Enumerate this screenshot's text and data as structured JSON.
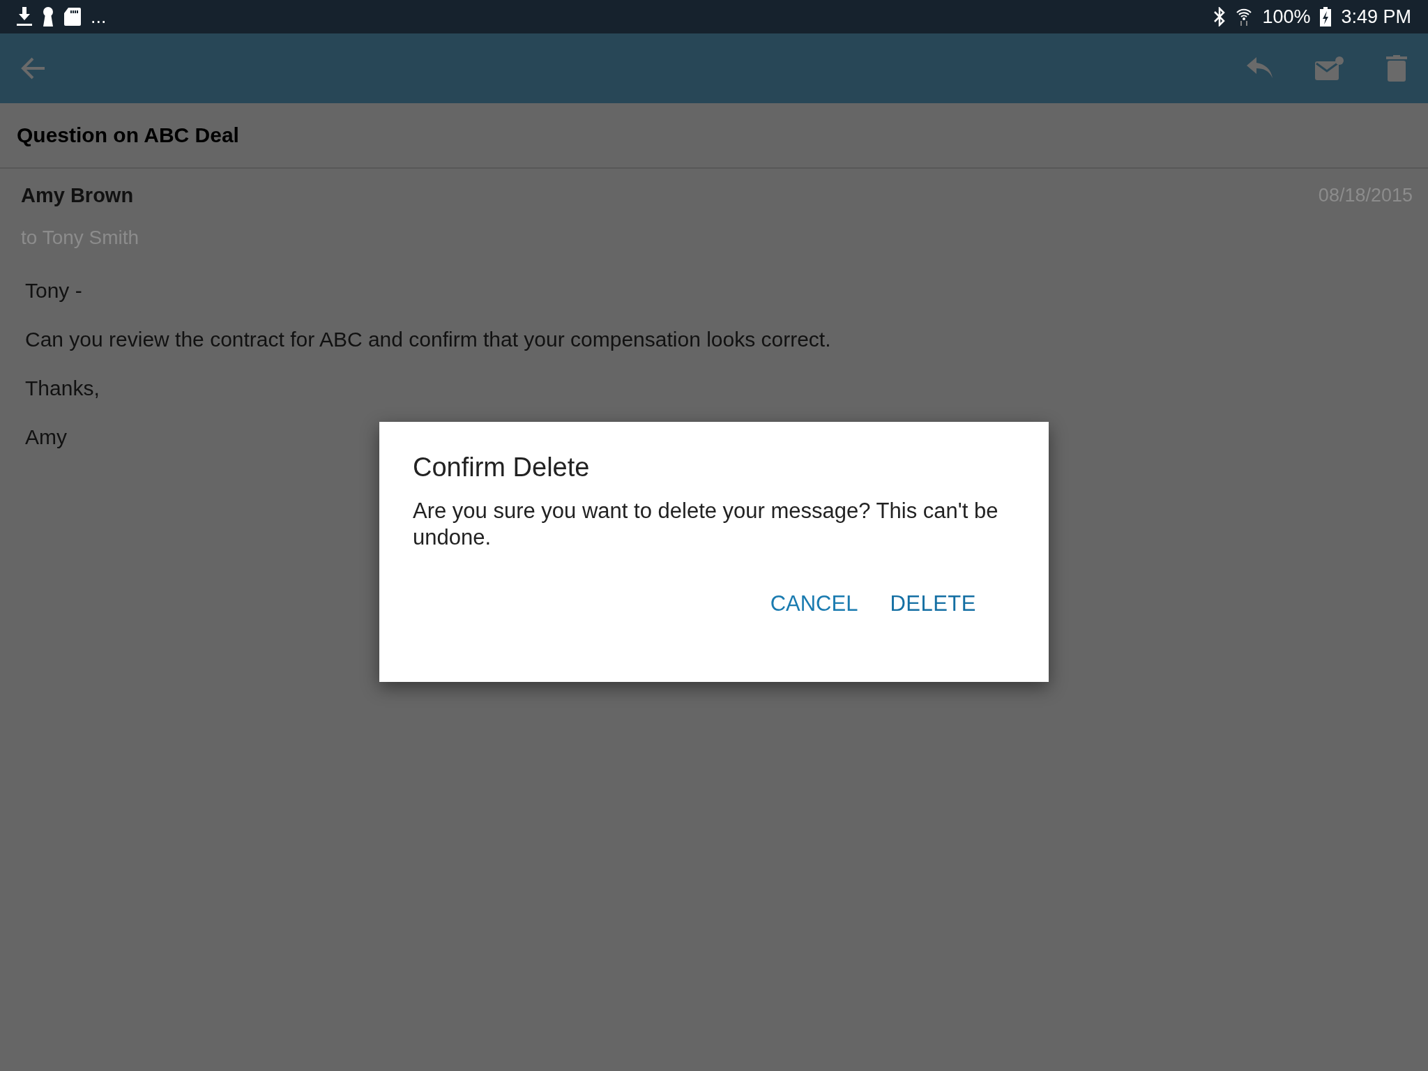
{
  "status_bar": {
    "overflow": "...",
    "battery": "100%",
    "time": "3:49 PM"
  },
  "subject": "Question on ABC Deal",
  "message": {
    "sender": "Amy Brown",
    "date": "08/18/2015",
    "recipient": "to Tony Smith",
    "body": [
      "Tony -",
      "Can you review the contract for ABC and confirm that your compensation looks correct.",
      "Thanks,",
      "Amy"
    ]
  },
  "dialog": {
    "title": "Confirm Delete",
    "text": "Are you sure you want to delete your message? This can't be undone.",
    "buttons": [
      {
        "label": "CANCEL",
        "kind": "cancel"
      },
      {
        "label": "DELETE",
        "kind": "confirm"
      }
    ]
  }
}
